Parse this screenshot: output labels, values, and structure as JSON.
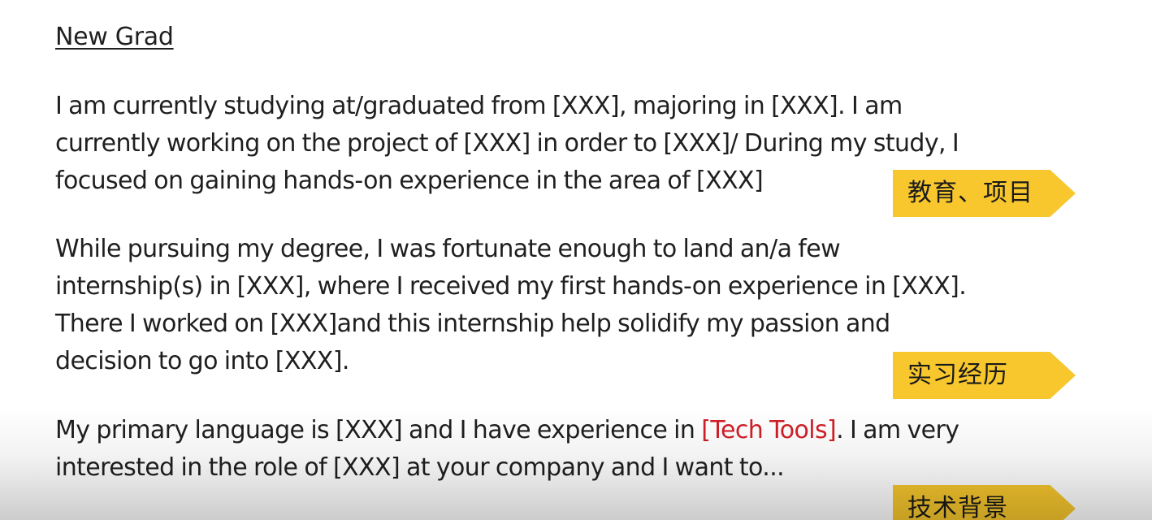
{
  "title": "New Grad",
  "paragraphs": [
    {
      "lines": [
        "I am currently studying at/graduated from [XXX], majoring in [XXX]. I am",
        "currently working on the project of [XXX] in order to [XXX]/ During my study, I",
        "focused on gaining hands-on experience in the area of [XXX]"
      ]
    },
    {
      "lines": [
        "While pursuing my degree, I was fortunate enough to land an/a few",
        "internship(s) in [XXX], where I received my first hands-on experience in [XXX].",
        "There I worked on [XXX]and this internship help solidify my passion and",
        "decision to go into [XXX]."
      ]
    },
    {
      "line1_before": "My primary language is [XXX] and I have experience in ",
      "line1_highlight": "[Tech Tools]",
      "line1_after": ". I am very",
      "line2": "interested in the role of [XXX] at your company and I want to..."
    }
  ],
  "tags": [
    {
      "label": "教育、项目"
    },
    {
      "label": "实习经历"
    },
    {
      "label": "技术背景"
    }
  ],
  "colors": {
    "tag_background": "#f7c72d",
    "highlight_text": "#d11f28",
    "body_text": "#1f1f1f"
  }
}
